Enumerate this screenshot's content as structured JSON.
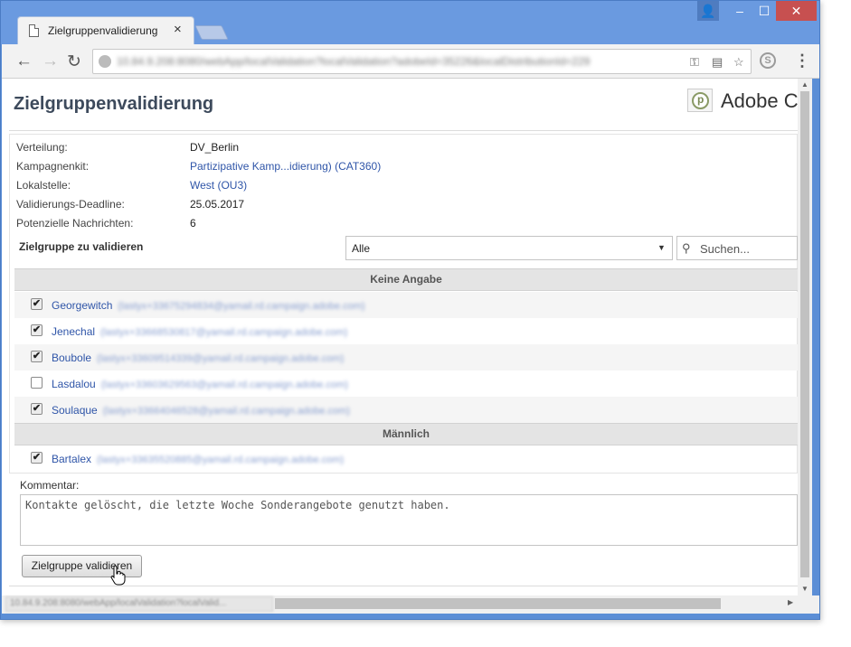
{
  "browser": {
    "tab_title": "Zielgruppenvalidierung",
    "tab_close": "×",
    "url": "10.84.9.208:8080/webApp/localValidation?localValidation?adobeId=35226&localDistributionId=229",
    "status_url": "10.84.9.208:8080/webApp/localValidation?localValid...",
    "window_buttons": {
      "user": "👤",
      "minimize": "–",
      "maximize": "☐",
      "close": "✕"
    },
    "nav": {
      "back": "←",
      "forward": "→",
      "reload": "↻",
      "menu": "⋮",
      "ext": "S"
    }
  },
  "page": {
    "title": "Zielgruppenvalidierung",
    "logo_text": "Adobe Ca",
    "info": [
      {
        "label": "Verteilung:",
        "value": "DV_Berlin",
        "link": false
      },
      {
        "label": "Kampagnenkit:",
        "value": "Partizipative Kamp...idierung) (CAT360)",
        "link": true
      },
      {
        "label": "Lokalstelle:",
        "value": "West (OU3)",
        "link": true
      },
      {
        "label": "Validierungs-Deadline:",
        "value": "25.05.2017",
        "link": false
      },
      {
        "label": "Potenzielle Nachrichten:",
        "value": "6",
        "link": false
      }
    ],
    "zielgruppe_label": "Zielgruppe zu validieren",
    "filter_value": "Alle",
    "search_placeholder": "Suchen...",
    "groups": [
      {
        "header": "Keine Angabe",
        "rows": [
          {
            "name": "Georgewitch",
            "email": "(lastyx+33675294834@yamail.rd.campaign.adobe.com)",
            "checked": true
          },
          {
            "name": "Jenechal",
            "email": "(lastyx+33668530817@yamail.rd.campaign.adobe.com)",
            "checked": true
          },
          {
            "name": "Boubole",
            "email": "(lastyx+33609514339@yamail.rd.campaign.adobe.com)",
            "checked": true
          },
          {
            "name": "Lasdalou",
            "email": "(lastyx+33603629563@yamail.rd.campaign.adobe.com)",
            "checked": false
          },
          {
            "name": "Soulaque",
            "email": "(lastyx+33664046528@yamail.rd.campaign.adobe.com)",
            "checked": true
          }
        ]
      },
      {
        "header": "Männlich",
        "rows": [
          {
            "name": "Bartalex",
            "email": "(lastyx+33635520885@yamail.rd.campaign.adobe.com)",
            "checked": true
          }
        ]
      }
    ],
    "comment_label": "Kommentar:",
    "comment_text": "Kontakte gelöscht, die letzte Woche Sonderangebote genutzt haben.",
    "validate_button": "Zielgruppe validieren",
    "checkmark": "✔",
    "search_icon": "⚲",
    "select_arrow": "▼"
  },
  "colors": {
    "window_frame": "#5b8ed6",
    "link": "#2f55a8",
    "group_header_bg": "#e4e4e4",
    "close_button": "#c75050"
  }
}
